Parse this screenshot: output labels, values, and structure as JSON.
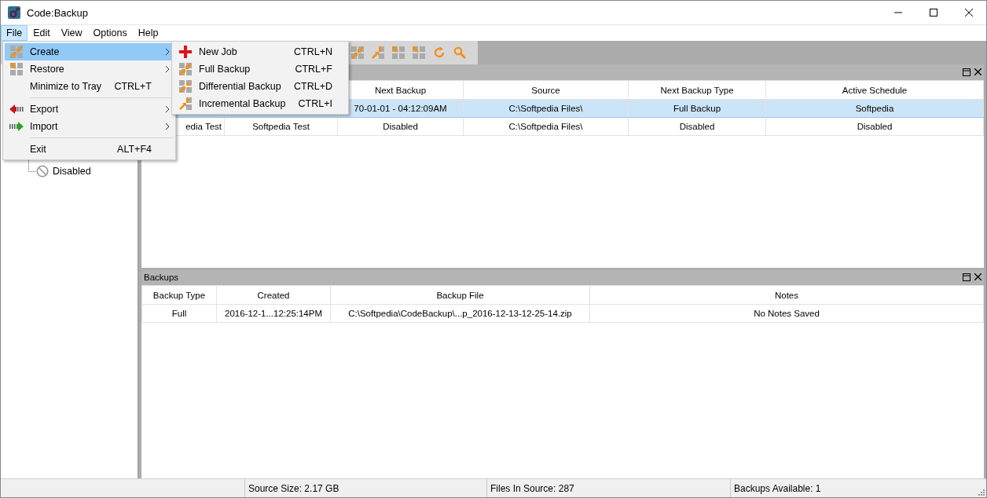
{
  "window": {
    "title": "Code:Backup"
  },
  "menu_bar": [
    {
      "label": "File",
      "selected": true
    },
    {
      "label": "Edit",
      "selected": false
    },
    {
      "label": "View",
      "selected": false
    },
    {
      "label": "Options",
      "selected": false
    },
    {
      "label": "Help",
      "selected": false
    }
  ],
  "file_menu": {
    "items": [
      {
        "kind": "item",
        "label": "Create",
        "submenu": true,
        "selected": true
      },
      {
        "kind": "item",
        "label": "Restore",
        "submenu": true,
        "selected": false
      },
      {
        "kind": "item",
        "label": "Minimize to Tray",
        "shortcut": "CTRL+T",
        "selected": false
      },
      {
        "kind": "separator"
      },
      {
        "kind": "item",
        "label": "Export",
        "submenu": true,
        "selected": false
      },
      {
        "kind": "item",
        "label": "Import",
        "submenu": true,
        "selected": false
      },
      {
        "kind": "separator"
      },
      {
        "kind": "item",
        "label": "Exit",
        "shortcut": "ALT+F4",
        "selected": false
      }
    ]
  },
  "create_submenu": {
    "items": [
      {
        "label": "New Job",
        "shortcut": "CTRL+N"
      },
      {
        "label": "Full Backup",
        "shortcut": "CTRL+F"
      },
      {
        "label": "Differential Backup",
        "shortcut": "CTRL+D"
      },
      {
        "label": "Incremental Backup",
        "shortcut": "CTRL+I"
      }
    ]
  },
  "tree": {
    "items": [
      {
        "label": "Disabled"
      }
    ]
  },
  "jobs_table": {
    "columns": [
      null,
      null,
      "Next Backup",
      "Source",
      "Next Backup Type",
      "Active Schedule"
    ],
    "rows": [
      {
        "selected": true,
        "cells": [
          null,
          null,
          "70-01-01 - 04:12:09AM",
          "C:\\Softpedia Files\\",
          "Full Backup",
          "Softpedia"
        ]
      },
      {
        "selected": false,
        "cells": [
          "edia Test",
          "Softpedia Test",
          "Disabled",
          "C:\\Softpedia Files\\",
          "Disabled",
          "Disabled"
        ]
      }
    ]
  },
  "backups_panel": {
    "title": "Backups",
    "columns": [
      "Backup Type",
      "Created",
      "Backup File",
      "Notes"
    ],
    "rows": [
      {
        "selected": false,
        "cells": [
          "Full",
          "2016-12-1...12:25:14PM",
          "C:\\Softpedia\\CodeBackup\\...p_2016-12-13-12-25-14.zip",
          "No Notes Saved"
        ]
      }
    ]
  },
  "status_bar": [
    "Source Size: 2.17 GB",
    "Files In Source: 287",
    "Backups Available: 1"
  ]
}
